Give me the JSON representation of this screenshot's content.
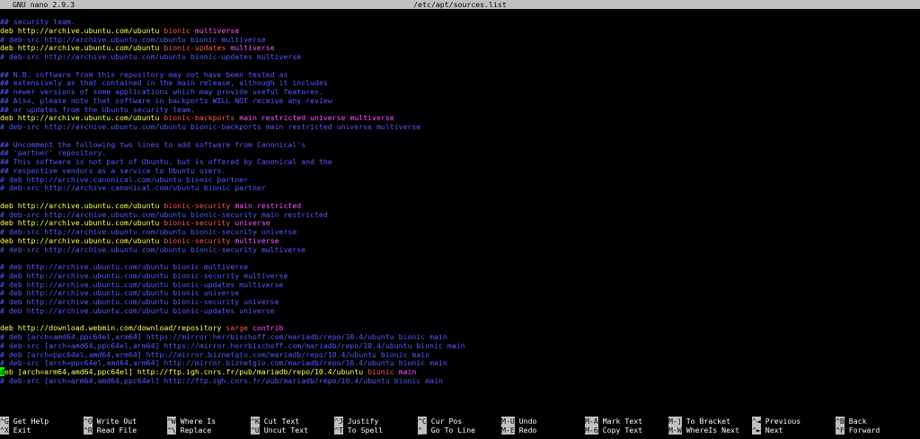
{
  "titlebar": {
    "app": "GNU nano 2.9.3",
    "file": "/etc/apt/sources.list"
  },
  "lines": [
    [
      {
        "t": "## security team.",
        "c": "cm"
      }
    ],
    [
      {
        "t": "deb http://archive.ubuntu.com/ubuntu ",
        "c": "kw"
      },
      {
        "t": "bionic ",
        "c": "dist"
      },
      {
        "t": "multiverse",
        "c": "comp"
      }
    ],
    [
      {
        "t": "# deb-src http://archive.ubuntu.com/ubuntu bionic multiverse",
        "c": "cm"
      }
    ],
    [
      {
        "t": "deb http://archive.ubuntu.com/ubuntu ",
        "c": "kw"
      },
      {
        "t": "bionic-updates ",
        "c": "dist"
      },
      {
        "t": "multiverse",
        "c": "comp"
      }
    ],
    [
      {
        "t": "# deb-src http://archive.ubuntu.com/ubuntu bionic-updates multiverse",
        "c": "cm"
      }
    ],
    [
      {
        "t": "",
        "c": ""
      }
    ],
    [
      {
        "t": "## N.B. software from this repository may not have been tested as",
        "c": "cm"
      }
    ],
    [
      {
        "t": "## extensively as that contained in the main release, although it includes",
        "c": "cm"
      }
    ],
    [
      {
        "t": "## newer versions of some applications which may provide useful features.",
        "c": "cm"
      }
    ],
    [
      {
        "t": "## Also, please note that software in backports WILL NOT receive any review",
        "c": "cm"
      }
    ],
    [
      {
        "t": "## or updates from the Ubuntu security team.",
        "c": "cm"
      }
    ],
    [
      {
        "t": "deb http://archive.ubuntu.com/ubuntu ",
        "c": "kw"
      },
      {
        "t": "bionic-backports ",
        "c": "dist"
      },
      {
        "t": "main restricted universe multiverse",
        "c": "comp"
      }
    ],
    [
      {
        "t": "# deb-src http://archive.ubuntu.com/ubuntu bionic-backports main restricted universe multiverse",
        "c": "cm"
      }
    ],
    [
      {
        "t": "",
        "c": ""
      }
    ],
    [
      {
        "t": "## Uncomment the following two lines to add software from Canonical's",
        "c": "cm"
      }
    ],
    [
      {
        "t": "## 'partner' repository.",
        "c": "cm"
      }
    ],
    [
      {
        "t": "## This software is not part of Ubuntu, but is offered by Canonical and the",
        "c": "cm"
      }
    ],
    [
      {
        "t": "## respective vendors as a service to Ubuntu users.",
        "c": "cm"
      }
    ],
    [
      {
        "t": "# deb http://archive.canonical.com/ubuntu bionic partner",
        "c": "cm"
      }
    ],
    [
      {
        "t": "# deb-src http://archive.canonical.com/ubuntu bionic partner",
        "c": "cm"
      }
    ],
    [
      {
        "t": "",
        "c": ""
      }
    ],
    [
      {
        "t": "deb http://archive.ubuntu.com/ubuntu ",
        "c": "kw"
      },
      {
        "t": "bionic-security ",
        "c": "dist"
      },
      {
        "t": "main restricted",
        "c": "comp"
      }
    ],
    [
      {
        "t": "# deb-src http://archive.ubuntu.com/ubuntu bionic-security main restricted",
        "c": "cm"
      }
    ],
    [
      {
        "t": "deb http://archive.ubuntu.com/ubuntu ",
        "c": "kw"
      },
      {
        "t": "bionic-security ",
        "c": "dist"
      },
      {
        "t": "universe",
        "c": "comp"
      }
    ],
    [
      {
        "t": "# deb-src http://archive.ubuntu.com/ubuntu bionic-security universe",
        "c": "cm"
      }
    ],
    [
      {
        "t": "deb http://archive.ubuntu.com/ubuntu ",
        "c": "kw"
      },
      {
        "t": "bionic-security ",
        "c": "dist"
      },
      {
        "t": "multiverse",
        "c": "comp"
      }
    ],
    [
      {
        "t": "# deb-src http://archive.ubuntu.com/ubuntu bionic-security multiverse",
        "c": "cm"
      }
    ],
    [
      {
        "t": "",
        "c": ""
      }
    ],
    [
      {
        "t": "# deb http://archive.ubuntu.com/ubuntu bionic multiverse",
        "c": "cm"
      }
    ],
    [
      {
        "t": "# deb http://archive.ubuntu.com/ubuntu bionic-security multiverse",
        "c": "cm"
      }
    ],
    [
      {
        "t": "# deb http://archive.ubuntu.com/ubuntu bionic-updates multiverse",
        "c": "cm"
      }
    ],
    [
      {
        "t": "# deb http://archive.ubuntu.com/ubuntu bionic universe",
        "c": "cm"
      }
    ],
    [
      {
        "t": "# deb http://archive.ubuntu.com/ubuntu bionic-security universe",
        "c": "cm"
      }
    ],
    [
      {
        "t": "# deb http://archive.ubuntu.com/ubuntu bionic-updates universe",
        "c": "cm"
      }
    ],
    [
      {
        "t": "",
        "c": ""
      }
    ],
    [
      {
        "t": "deb http://download.webmin.com/download/repository ",
        "c": "kw"
      },
      {
        "t": "sarge ",
        "c": "dist"
      },
      {
        "t": "contrib",
        "c": "comp"
      }
    ],
    [
      {
        "t": "# deb [arch=amd64,ppc64el,arm64] https://mirror.herrbischoff.com/mariadb/repo/10.4/ubuntu bionic main",
        "c": "cm"
      }
    ],
    [
      {
        "t": "# deb-src [arch=amd64,ppc64el,arm64] https://mirror.herrbischoff.com/mariadb/repo/10.4/ubuntu bionic main",
        "c": "cm"
      }
    ],
    [
      {
        "t": "# deb [arch=ppc64el,amd64,arm64] http://mirror.biznetgio.com/mariadb/repo/10.4/ubuntu bionic main",
        "c": "cm"
      }
    ],
    [
      {
        "t": "# deb-src [arch=ppc64el,amd64,arm64] http://mirror.biznetgio.com/mariadb/repo/10.4/ubuntu bionic main",
        "c": "cm"
      }
    ],
    [
      {
        "t": "d",
        "c": "cursor"
      },
      {
        "t": "eb [arch=arm64,amd64,ppc64el] http://ftp.igh.cnrs.fr/pub/mariadb/repo/10.4/ubuntu ",
        "c": "kw"
      },
      {
        "t": "bionic ",
        "c": "dist"
      },
      {
        "t": "main",
        "c": "comp"
      }
    ],
    [
      {
        "t": "# deb-src [arch=arm64,amd64,ppc64el] http://ftp.igh.cnrs.fr/pub/mariadb/repo/10.4/ubuntu bionic main",
        "c": "cm"
      }
    ]
  ],
  "shortcuts": [
    {
      "key": "^G",
      "label": "Get Help"
    },
    {
      "key": "^X",
      "label": "Exit"
    },
    {
      "key": "^O",
      "label": "Write Out"
    },
    {
      "key": "^R",
      "label": "Read File"
    },
    {
      "key": "^W",
      "label": "Where Is"
    },
    {
      "key": "^\\",
      "label": "Replace"
    },
    {
      "key": "^K",
      "label": "Cut Text"
    },
    {
      "key": "^U",
      "label": "Uncut Text"
    },
    {
      "key": "^J",
      "label": "Justify"
    },
    {
      "key": "^T",
      "label": "To Spell"
    },
    {
      "key": "^C",
      "label": "Cur Pos"
    },
    {
      "key": "^_",
      "label": "Go To Line"
    },
    {
      "key": "M-U",
      "label": "Undo"
    },
    {
      "key": "M-E",
      "label": "Redo"
    },
    {
      "key": "M-A",
      "label": "Mark Text"
    },
    {
      "key": "M-6",
      "label": "Copy Text"
    },
    {
      "key": "M-]",
      "label": "To Bracket"
    },
    {
      "key": "M-W",
      "label": "WhereIs Next"
    },
    {
      "key": "^◄",
      "label": "Previous"
    },
    {
      "key": "^►",
      "label": "Next"
    },
    {
      "key": "^B",
      "label": "Back"
    },
    {
      "key": "^F",
      "label": "Forward"
    }
  ]
}
